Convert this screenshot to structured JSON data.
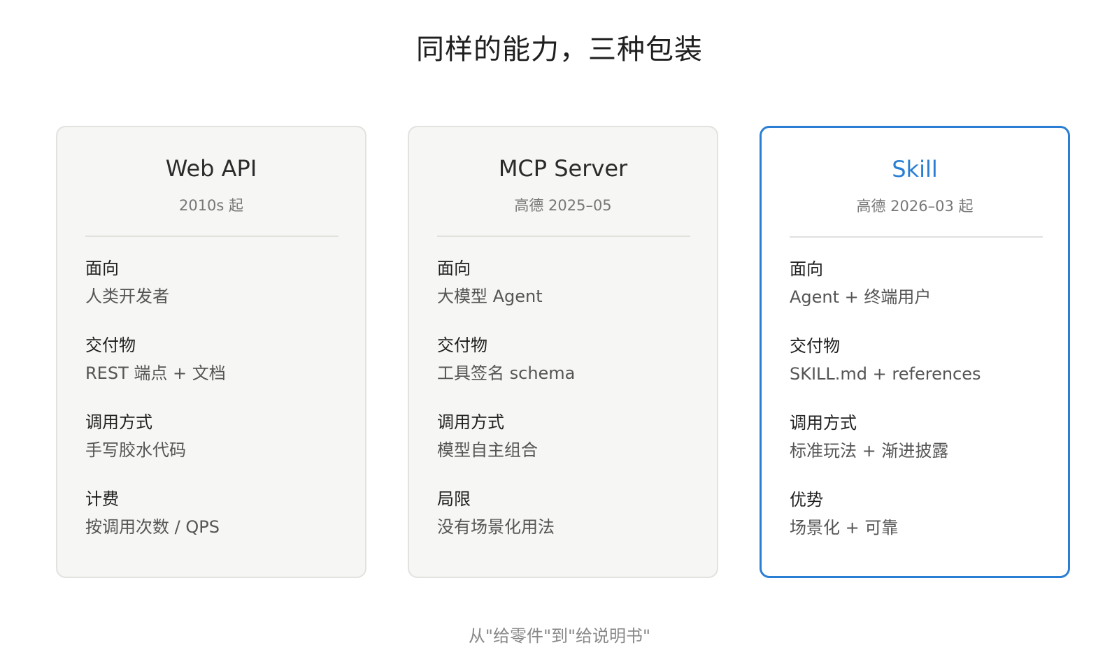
{
  "title": "同样的能力，三种包装",
  "cards": [
    {
      "name": "Web API",
      "subtitle": "2010s 起",
      "fields": [
        {
          "label": "面向",
          "value": "人类开发者"
        },
        {
          "label": "交付物",
          "value": "REST 端点 + 文档"
        },
        {
          "label": "调用方式",
          "value": "手写胶水代码"
        },
        {
          "label": "计费",
          "value": "按调用次数 / QPS"
        }
      ]
    },
    {
      "name": "MCP Server",
      "subtitle": "高德 2025–05",
      "fields": [
        {
          "label": "面向",
          "value": "大模型 Agent"
        },
        {
          "label": "交付物",
          "value": "工具签名 schema"
        },
        {
          "label": "调用方式",
          "value": "模型自主组合"
        },
        {
          "label": "局限",
          "value": "没有场景化用法"
        }
      ]
    },
    {
      "name": "Skill",
      "subtitle": "高德 2026–03 起",
      "fields": [
        {
          "label": "面向",
          "value": "Agent + 终端用户"
        },
        {
          "label": "交付物",
          "value": "SKILL.md + references"
        },
        {
          "label": "调用方式",
          "value": "标准玩法 + 渐进披露"
        },
        {
          "label": "优势",
          "value": "场景化 + 可靠"
        }
      ]
    }
  ],
  "highlight_color": "#2a7fd4",
  "footer": "从\"给零件\"到\"给说明书\""
}
